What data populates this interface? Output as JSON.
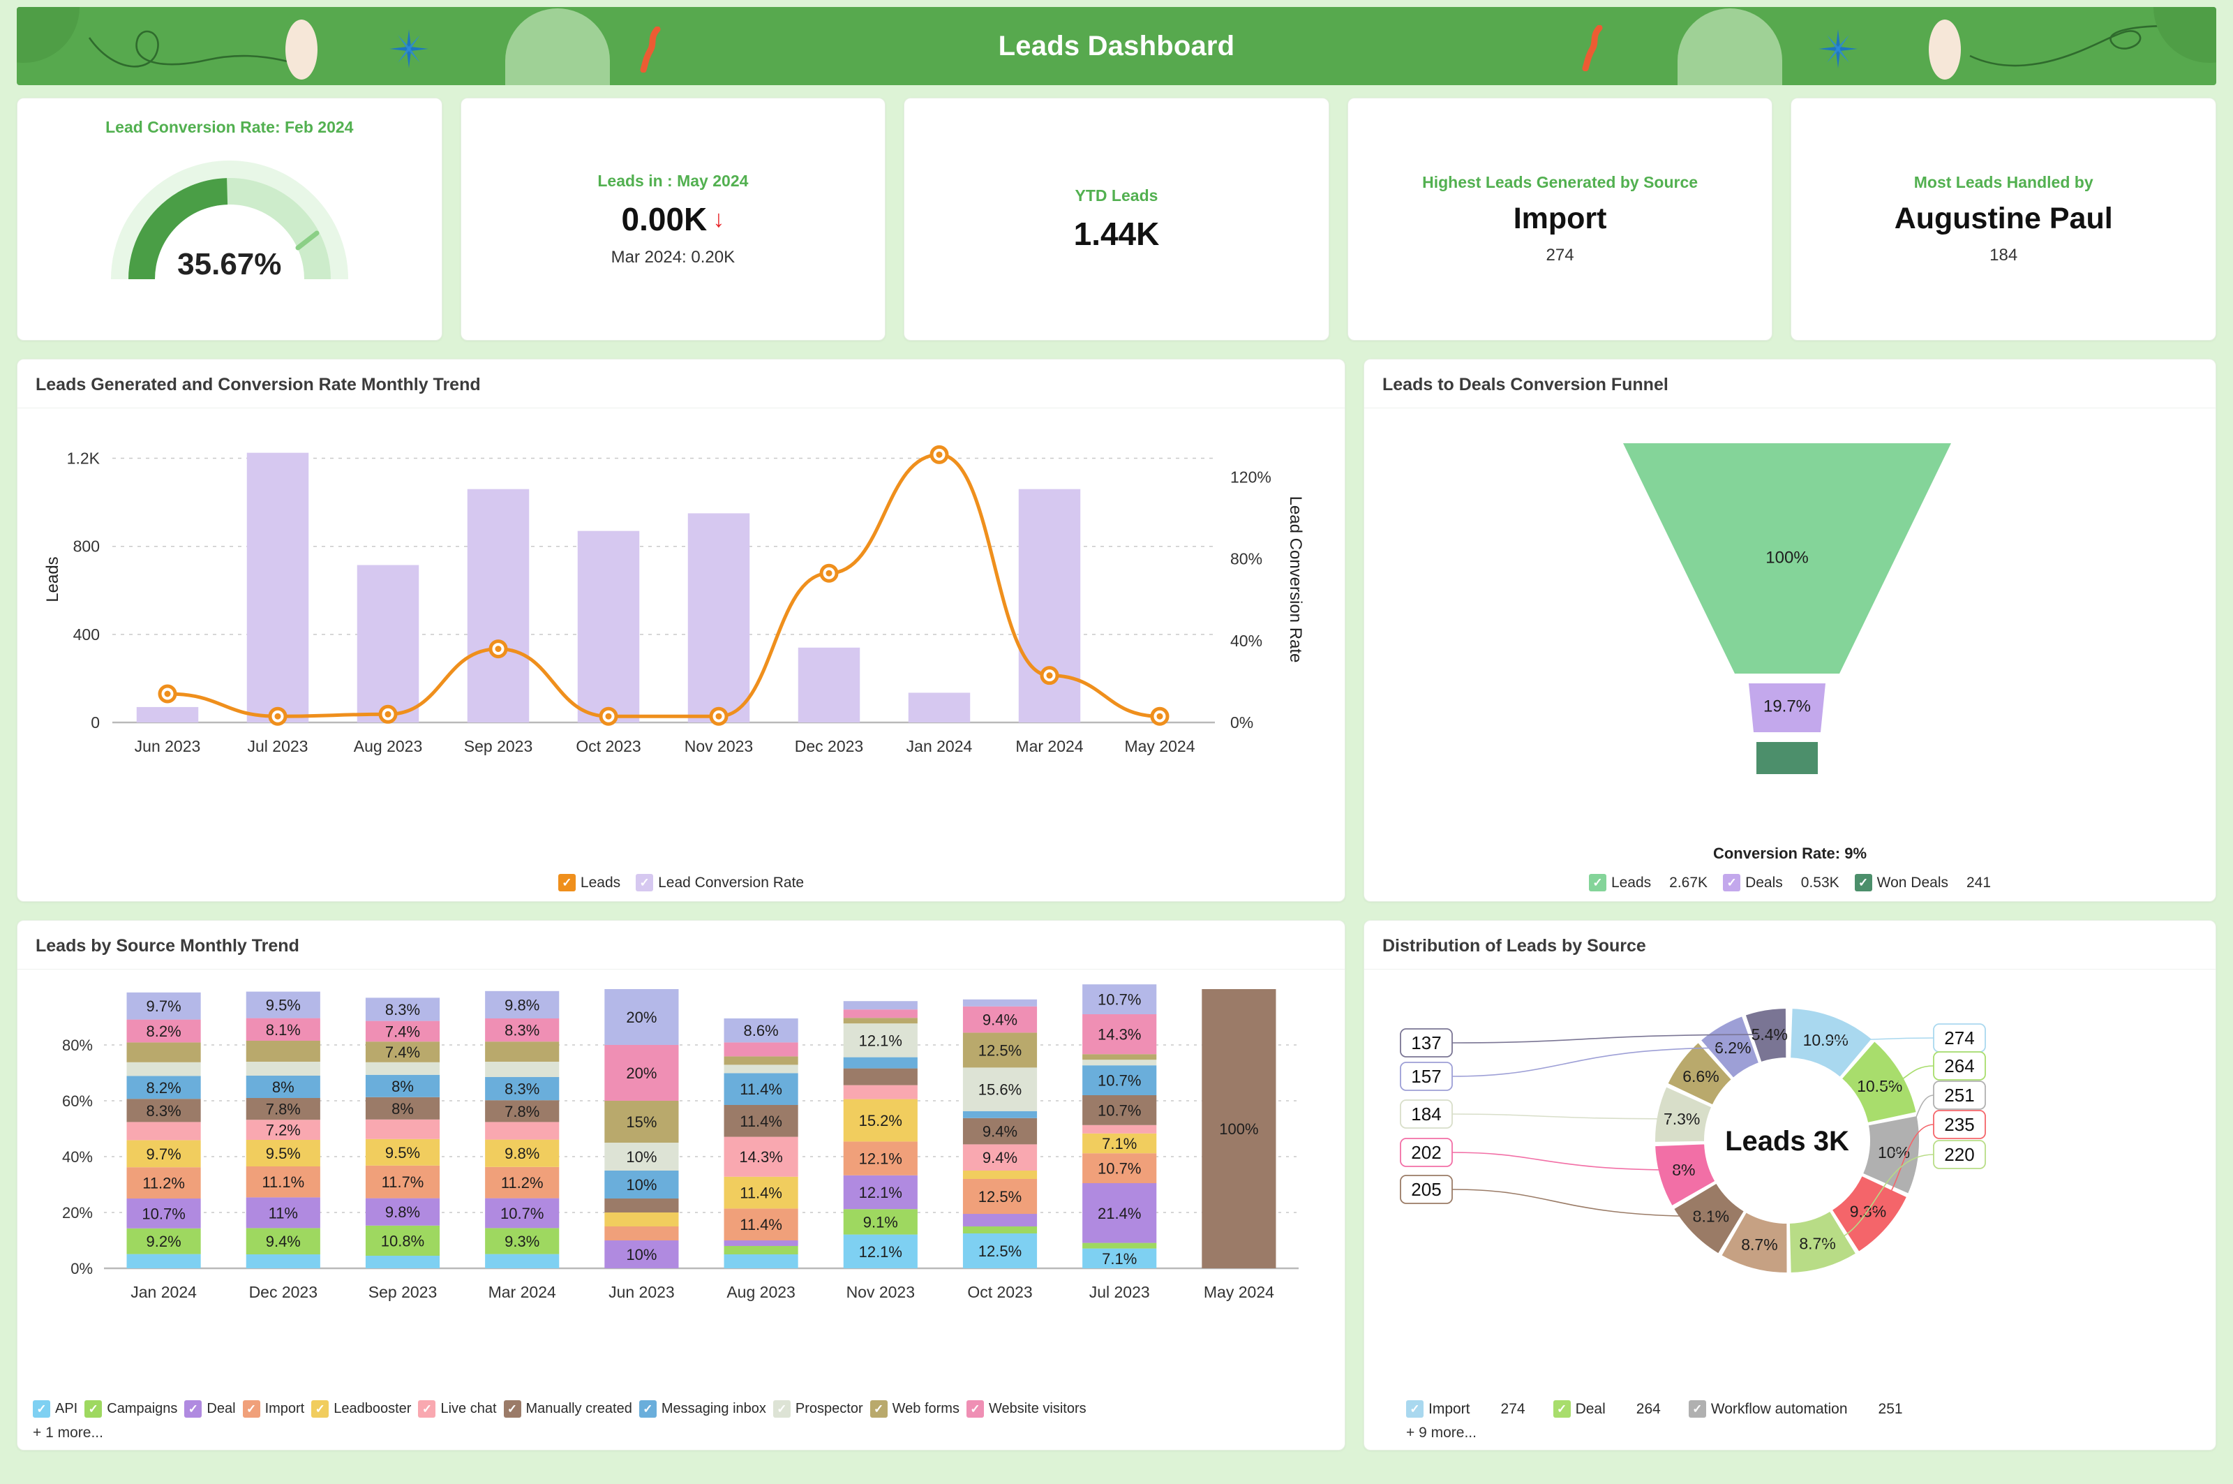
{
  "header": {
    "title": "Leads Dashboard",
    "bg_color": "#57a94e",
    "page_bg": "#ddf3d6"
  },
  "kpis": [
    {
      "title": "Lead Conversion Rate: Feb 2024",
      "type": "gauge",
      "value": "35.67%",
      "gauge_percent": 35.67,
      "gauge_fill": "#4a9e46",
      "gauge_track": "#cdeccb",
      "gauge_bg": "#e8f7e7"
    },
    {
      "title": "Leads in : May 2024",
      "type": "value",
      "value": "0.00K",
      "trend_arrow": "↓",
      "trend_color": "#e8262b",
      "sub": "Mar 2024: 0.20K"
    },
    {
      "title": "YTD Leads",
      "type": "value",
      "value": "1.44K",
      "sub": ""
    },
    {
      "title": "Highest Leads Generated by Source",
      "type": "value",
      "value": "Import",
      "sub": "274"
    },
    {
      "title": "Most Leads Handled by",
      "type": "value",
      "value": "Augustine Paul",
      "sub": "184"
    }
  ],
  "panels": {
    "combo": {
      "title": "Leads Generated and Conversion Rate Monthly Trend"
    },
    "funnel": {
      "title": "Leads to Deals Conversion Funnel",
      "conversion_rate_label": "Conversion Rate: 9%"
    },
    "stacked": {
      "title": "Leads by Source Monthly Trend",
      "more": "+ 1 more..."
    },
    "donut": {
      "title": "Distribution of Leads by Source",
      "more": "+ 9 more..."
    }
  },
  "chart_data": [
    {
      "id": "combo",
      "type": "bar",
      "title": "Leads Generated and Conversion Rate Monthly Trend",
      "xlabel": "",
      "ylabel": "Leads",
      "y2label": "Lead Conversion Rate",
      "ylim": [
        0,
        1300
      ],
      "yticks": [
        0,
        400,
        800,
        1200
      ],
      "ytick_labels": [
        "0",
        "400",
        "800",
        "1.2K"
      ],
      "y2lim": [
        0,
        140
      ],
      "y2ticks": [
        0,
        40,
        80,
        120
      ],
      "y2tick_labels": [
        "0%",
        "40%",
        "80%",
        "120%"
      ],
      "grid": true,
      "legend_position": "bottom",
      "categories": [
        "Jun 2023",
        "Jul 2023",
        "Aug 2023",
        "Sep 2023",
        "Oct 2023",
        "Nov 2023",
        "Dec 2023",
        "Jan 2024",
        "Mar 2024",
        "May 2024"
      ],
      "series": [
        {
          "name": "Lead Conversion Rate",
          "chart": "bar",
          "color": "#d6c8f0",
          "values": [
            70,
            1225,
            715,
            1060,
            870,
            950,
            340,
            135,
            1060,
            0
          ]
        },
        {
          "name": "Leads",
          "chart": "line",
          "color": "#ef8f1c",
          "unit": "%",
          "values": [
            14,
            3,
            4,
            36,
            3,
            3,
            73,
            131,
            23,
            3
          ]
        }
      ]
    },
    {
      "id": "funnel",
      "type": "bar",
      "title": "Leads to Deals Conversion Funnel",
      "annotation": "Conversion Rate: 9%",
      "legend_position": "bottom",
      "stages": [
        {
          "name": "Leads",
          "percent_label": "100%",
          "value_label": "2.67K",
          "color": "#84d499"
        },
        {
          "name": "Deals",
          "percent_label": "19.7%",
          "value_label": "0.53K",
          "color": "#c3a8ec"
        },
        {
          "name": "Won Deals",
          "percent_label": "",
          "value_label": "241",
          "color": "#4c8f6b"
        }
      ]
    },
    {
      "id": "stacked",
      "type": "bar",
      "title": "Leads by Source Monthly Trend",
      "stacked": true,
      "ylim": [
        0,
        100
      ],
      "yticks": [
        0,
        20,
        40,
        60,
        80
      ],
      "ytick_labels": [
        "0%",
        "20%",
        "40%",
        "60%",
        "80%"
      ],
      "grid": true,
      "legend_position": "bottom",
      "categories": [
        "Jan 2024",
        "Dec 2023",
        "Sep 2023",
        "Mar 2024",
        "Jun 2023",
        "Aug 2023",
        "Nov 2023",
        "Oct 2023",
        "Jul 2023",
        "May 2024"
      ],
      "series": [
        {
          "name": "API",
          "color": "#7ed0f2",
          "values": [
            5.1,
            5.0,
            4.5,
            5.1,
            0,
            5.0,
            12.1,
            12.5,
            7.1,
            0
          ]
        },
        {
          "name": "Campaigns",
          "color": "#9ed860",
          "values": [
            9.2,
            9.4,
            10.8,
            9.3,
            0,
            3.0,
            9.1,
            2.5,
            2.0,
            0
          ]
        },
        {
          "name": "Deal",
          "color": "#b08ae0",
          "values": [
            10.7,
            11.0,
            9.8,
            10.7,
            10.0,
            2.0,
            12.1,
            4.5,
            21.4,
            0
          ]
        },
        {
          "name": "Import",
          "color": "#f0a07a",
          "values": [
            11.2,
            11.1,
            11.7,
            11.2,
            5.0,
            11.4,
            12.1,
            12.5,
            10.7,
            0
          ]
        },
        {
          "name": "Leadbooster",
          "color": "#f1cd5e",
          "values": [
            9.7,
            9.5,
            9.5,
            9.8,
            5.0,
            11.4,
            15.2,
            3.0,
            7.1,
            0
          ]
        },
        {
          "name": "Live chat",
          "color": "#f9a8b0",
          "values": [
            6.5,
            7.2,
            7.0,
            6.3,
            0,
            14.3,
            5.0,
            9.4,
            3.0,
            0
          ]
        },
        {
          "name": "Manually created",
          "color": "#9b7b68",
          "values": [
            8.3,
            7.8,
            8.0,
            7.8,
            5.0,
            11.4,
            6.0,
            9.4,
            10.7,
            100
          ]
        },
        {
          "name": "Messaging inbox",
          "color": "#6aaedb",
          "values": [
            8.2,
            8.0,
            8.0,
            8.3,
            10.0,
            11.4,
            4.0,
            2.5,
            10.7,
            0
          ]
        },
        {
          "name": "Prospector",
          "color": "#dde3d5",
          "values": [
            4.9,
            5.0,
            4.5,
            5.5,
            10.0,
            3.0,
            12.1,
            15.6,
            2.0,
            0
          ]
        },
        {
          "name": "Web forms",
          "color": "#b9a96c",
          "values": [
            7.1,
            7.5,
            7.4,
            7.2,
            15.0,
            3.0,
            2.0,
            12.5,
            2.0,
            0
          ]
        },
        {
          "name": "Website visitors",
          "color": "#ef8fb4",
          "values": [
            8.2,
            8.1,
            7.4,
            8.3,
            20.0,
            5.0,
            3.0,
            9.4,
            14.3,
            0
          ]
        },
        {
          "name": "Workflow automation",
          "color": "#b4b8e8",
          "values": [
            9.7,
            9.5,
            8.3,
            9.8,
            20.0,
            8.6,
            3.0,
            2.5,
            10.7,
            0
          ]
        }
      ],
      "labels": {
        "Jan 2024": {
          "Campaigns": "9.2%",
          "Deal": "10.7%",
          "Import": "11.2%",
          "Leadbooster": "9.7%",
          "Manually created": "8.3%",
          "Messaging inbox": "8.2%",
          "Website visitors": "8.2%",
          "Workflow automation": "9.7%"
        },
        "Dec 2023": {
          "Campaigns": "9.4%",
          "Deal": "11%",
          "Import": "11.1%",
          "Leadbooster": "9.5%",
          "Live chat": "7.2%",
          "Manually created": "7.8%",
          "Messaging inbox": "8%",
          "Website visitors": "8.1%",
          "Workflow automation": "9.5%"
        },
        "Sep 2023": {
          "Campaigns": "10.8%",
          "Deal": "9.8%",
          "Import": "11.7%",
          "Leadbooster": "9.5%",
          "Manually created": "8%",
          "Messaging inbox": "8%",
          "Web forms": "7.4%",
          "Website visitors": "7.4%",
          "Workflow automation": "8.3%"
        },
        "Mar 2024": {
          "Campaigns": "9.3%",
          "Deal": "10.7%",
          "Import": "11.2%",
          "Leadbooster": "9.8%",
          "Manually created": "7.8%",
          "Messaging inbox": "8.3%",
          "Website visitors": "8.3%",
          "Workflow automation": "9.8%"
        },
        "Jun 2023": {
          "Deal": "10%",
          "Messaging inbox": "10%",
          "Prospector": "10%",
          "Web forms": "15%",
          "Website visitors": "20%",
          "Workflow automation": "20%"
        },
        "Aug 2023": {
          "Import": "11.4%",
          "Leadbooster": "11.4%",
          "Live chat": "14.3%",
          "Manually created": "11.4%",
          "Messaging inbox": "11.4%",
          "Workflow automation": "8.6%"
        },
        "Nov 2023": {
          "API": "12.1%",
          "Campaigns": "9.1%",
          "Deal": "12.1%",
          "Import": "12.1%",
          "Leadbooster": "15.2%",
          "Prospector": "12.1%"
        },
        "Oct 2023": {
          "API": "12.5%",
          "Import": "12.5%",
          "Live chat": "9.4%",
          "Manually created": "9.4%",
          "Prospector": "15.6%",
          "Web forms": "12.5%",
          "Website visitors": "9.4%"
        },
        "Jul 2023": {
          "API": "7.1%",
          "Deal": "21.4%",
          "Import": "10.7%",
          "Leadbooster": "7.1%",
          "Manually created": "10.7%",
          "Messaging inbox": "10.7%",
          "Website visitors": "14.3%",
          "Workflow automation": "10.7%"
        },
        "May 2024": {
          "Manually created": "100%"
        }
      }
    },
    {
      "id": "donut",
      "type": "pie",
      "title": "Distribution of Leads by Source",
      "center_label": "Leads 3K",
      "legend_position": "bottom",
      "slices": [
        {
          "name": "Import",
          "percent": 10.9,
          "percent_label": "10.9%",
          "value": 274,
          "color": "#a9d8ef"
        },
        {
          "name": "Deal",
          "percent": 10.5,
          "percent_label": "10.5%",
          "value": 264,
          "color": "#a8dd6c"
        },
        {
          "name": "Workflow automation",
          "percent": 10.0,
          "percent_label": "10%",
          "value": 251,
          "color": "#b0b0b0"
        },
        {
          "name": "Campaigns",
          "percent": 9.3,
          "percent_label": "9.3%",
          "value": 235,
          "color": "#f4656a"
        },
        {
          "name": "Leadbooster",
          "percent": 8.7,
          "percent_label": "8.7%",
          "value": 220,
          "color": "#b8dc86"
        },
        {
          "name": "Messaging inbox",
          "percent": 8.7,
          "percent_label": "8.7%",
          "value": 220,
          "color": "#c6a183"
        },
        {
          "name": "Manually created",
          "percent": 8.1,
          "percent_label": "8.1%",
          "value": 205,
          "color": "#9a7b66"
        },
        {
          "name": "Live chat",
          "percent": 8.0,
          "percent_label": "8%",
          "value": 202,
          "color": "#f26fa6"
        },
        {
          "name": "Prospector",
          "percent": 7.3,
          "percent_label": "7.3%",
          "value": 184,
          "color": "#d8dec9"
        },
        {
          "name": "Web forms",
          "percent": 6.6,
          "percent_label": "6.6%",
          "value": 157,
          "color": "#b9a96c"
        },
        {
          "name": "API",
          "percent": 6.2,
          "percent_label": "6.2%",
          "value": 157,
          "color": "#9d9fd6"
        },
        {
          "name": "Website visitors",
          "percent": 5.4,
          "percent_label": "5.4%",
          "value": 137,
          "color": "#7a7594"
        }
      ],
      "callouts_left": [
        "137",
        "157",
        "184",
        "202",
        "205"
      ],
      "callouts_right": [
        "274",
        "264",
        "251",
        "235",
        "220"
      ]
    }
  ],
  "legends": {
    "combo": [
      {
        "label": "Leads",
        "color": "#ef8f1c"
      },
      {
        "label": "Lead Conversion Rate",
        "color": "#d6c8f0"
      }
    ],
    "funnel": [
      {
        "label": "Leads",
        "color": "#84d499",
        "value": "2.67K"
      },
      {
        "label": "Deals",
        "color": "#c3a8ec",
        "value": "0.53K"
      },
      {
        "label": "Won Deals",
        "color": "#4c8f6b",
        "value": "241"
      }
    ],
    "stacked": [
      {
        "label": "API",
        "color": "#7ed0f2"
      },
      {
        "label": "Campaigns",
        "color": "#9ed860"
      },
      {
        "label": "Deal",
        "color": "#b08ae0"
      },
      {
        "label": "Import",
        "color": "#f0a07a"
      },
      {
        "label": "Leadbooster",
        "color": "#f1cd5e"
      },
      {
        "label": "Live chat",
        "color": "#f9a8b0"
      },
      {
        "label": "Manually created",
        "color": "#9b7b68"
      },
      {
        "label": "Messaging inbox",
        "color": "#6aaedb"
      },
      {
        "label": "Prospector",
        "color": "#dde3d5"
      },
      {
        "label": "Web forms",
        "color": "#b9a96c"
      },
      {
        "label": "Website visitors",
        "color": "#ef8fb4"
      }
    ],
    "donut": [
      {
        "label": "Import",
        "color": "#a9d8ef",
        "value": "274"
      },
      {
        "label": "Deal",
        "color": "#a8dd6c",
        "value": "264"
      },
      {
        "label": "Workflow automation",
        "color": "#b0b0b0",
        "value": "251"
      }
    ]
  }
}
